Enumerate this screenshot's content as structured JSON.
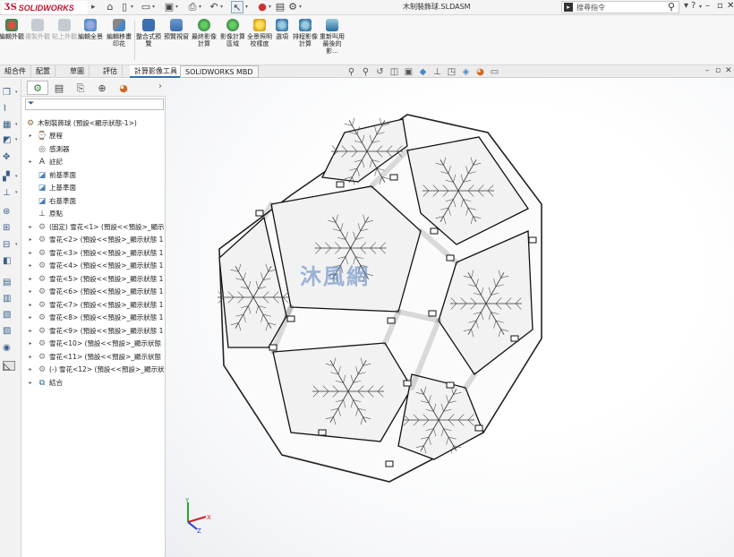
{
  "app": {
    "name": "SOLIDWORKS",
    "document_title": "木制裝飾球.SLDASM"
  },
  "search": {
    "placeholder": "搜尋指令"
  },
  "commands": [
    {
      "label": "編輯外觀",
      "enabled": true,
      "color": "#2e8b57"
    },
    {
      "label": "複製外觀",
      "enabled": false,
      "color": "#9aa6b2"
    },
    {
      "label": "貼上外觀",
      "enabled": false,
      "color": "#9aa6b2"
    },
    {
      "label": "編輯全景",
      "enabled": true,
      "color": "#4a86c8"
    },
    {
      "label": "編輯移畫印花",
      "enabled": true,
      "color": "#6a6a6a"
    },
    {
      "label": "整合式預覽",
      "enabled": true,
      "color": "#3c6fb0"
    },
    {
      "label": "預覽視窗",
      "enabled": true,
      "color": "#3c6fb0"
    },
    {
      "label": "最終影像計算",
      "enabled": true,
      "color": "#2a7a3a"
    },
    {
      "label": "影像計算區域",
      "enabled": true,
      "color": "#2a7a3a"
    },
    {
      "label": "全景照明校樣度",
      "enabled": true,
      "color": "#d4a017"
    },
    {
      "label": "選項",
      "enabled": true,
      "color": "#2a6aa0"
    },
    {
      "label": "排程影像計算",
      "enabled": true,
      "color": "#2a6aa0"
    },
    {
      "label": "重新叫用最後的影...",
      "enabled": true,
      "color": "#2a6aa0"
    }
  ],
  "tabs": [
    {
      "label": "組合件"
    },
    {
      "label": "配置"
    },
    {
      "label": "草圖"
    },
    {
      "label": "評估"
    },
    {
      "label": "計算影像工具"
    },
    {
      "label": "SOLIDWORKS MBD"
    }
  ],
  "feature_tree": {
    "root": "木制裝飾球 (預設<顯示狀態-1>)",
    "items": [
      {
        "label": "歷程",
        "icon": "history-icon",
        "expand": true
      },
      {
        "label": "感測器",
        "icon": "sensor-icon",
        "expand": false
      },
      {
        "label": "註記",
        "icon": "annotation-icon",
        "expand": true
      },
      {
        "label": "前基準面",
        "icon": "plane-icon",
        "expand": false
      },
      {
        "label": "上基準面",
        "icon": "plane-icon",
        "expand": false
      },
      {
        "label": "右基準面",
        "icon": "plane-icon",
        "expand": false
      },
      {
        "label": "原點",
        "icon": "origin-icon",
        "expand": false
      },
      {
        "label": "(固定) 雪花<1> (預設<<預設>_顯示",
        "icon": "part-icon",
        "expand": true
      },
      {
        "label": "雪花<2> (預設<<預設>_顯示狀態 1",
        "icon": "part-icon",
        "expand": true
      },
      {
        "label": "雪花<3> (預設<<預設>_顯示狀態 1",
        "icon": "part-icon",
        "expand": true
      },
      {
        "label": "雪花<4> (預設<<預設>_顯示狀態 1",
        "icon": "part-icon",
        "expand": true
      },
      {
        "label": "雪花<5> (預設<<預設>_顯示狀態 1",
        "icon": "part-icon",
        "expand": true
      },
      {
        "label": "雪花<6> (預設<<預設>_顯示狀態 1",
        "icon": "part-icon",
        "expand": true
      },
      {
        "label": "雪花<7> (預設<<預設>_顯示狀態 1",
        "icon": "part-icon",
        "expand": true
      },
      {
        "label": "雪花<8> (預設<<預設>_顯示狀態 1",
        "icon": "part-icon",
        "expand": true
      },
      {
        "label": "雪花<9> (預設<<預設>_顯示狀態 1",
        "icon": "part-icon",
        "expand": true
      },
      {
        "label": "雪花<10> (預設<<預設>_顯示狀態",
        "icon": "part-icon",
        "expand": true
      },
      {
        "label": "雪花<11> (預設<<預設>_顯示狀態",
        "icon": "part-icon",
        "expand": true
      },
      {
        "label": "(-) 雪花<12> (預設<<預設>_顯示狀",
        "icon": "part-icon",
        "expand": true
      },
      {
        "label": "結合",
        "icon": "mates-icon",
        "expand": true
      }
    ]
  },
  "watermark": "沐風網"
}
